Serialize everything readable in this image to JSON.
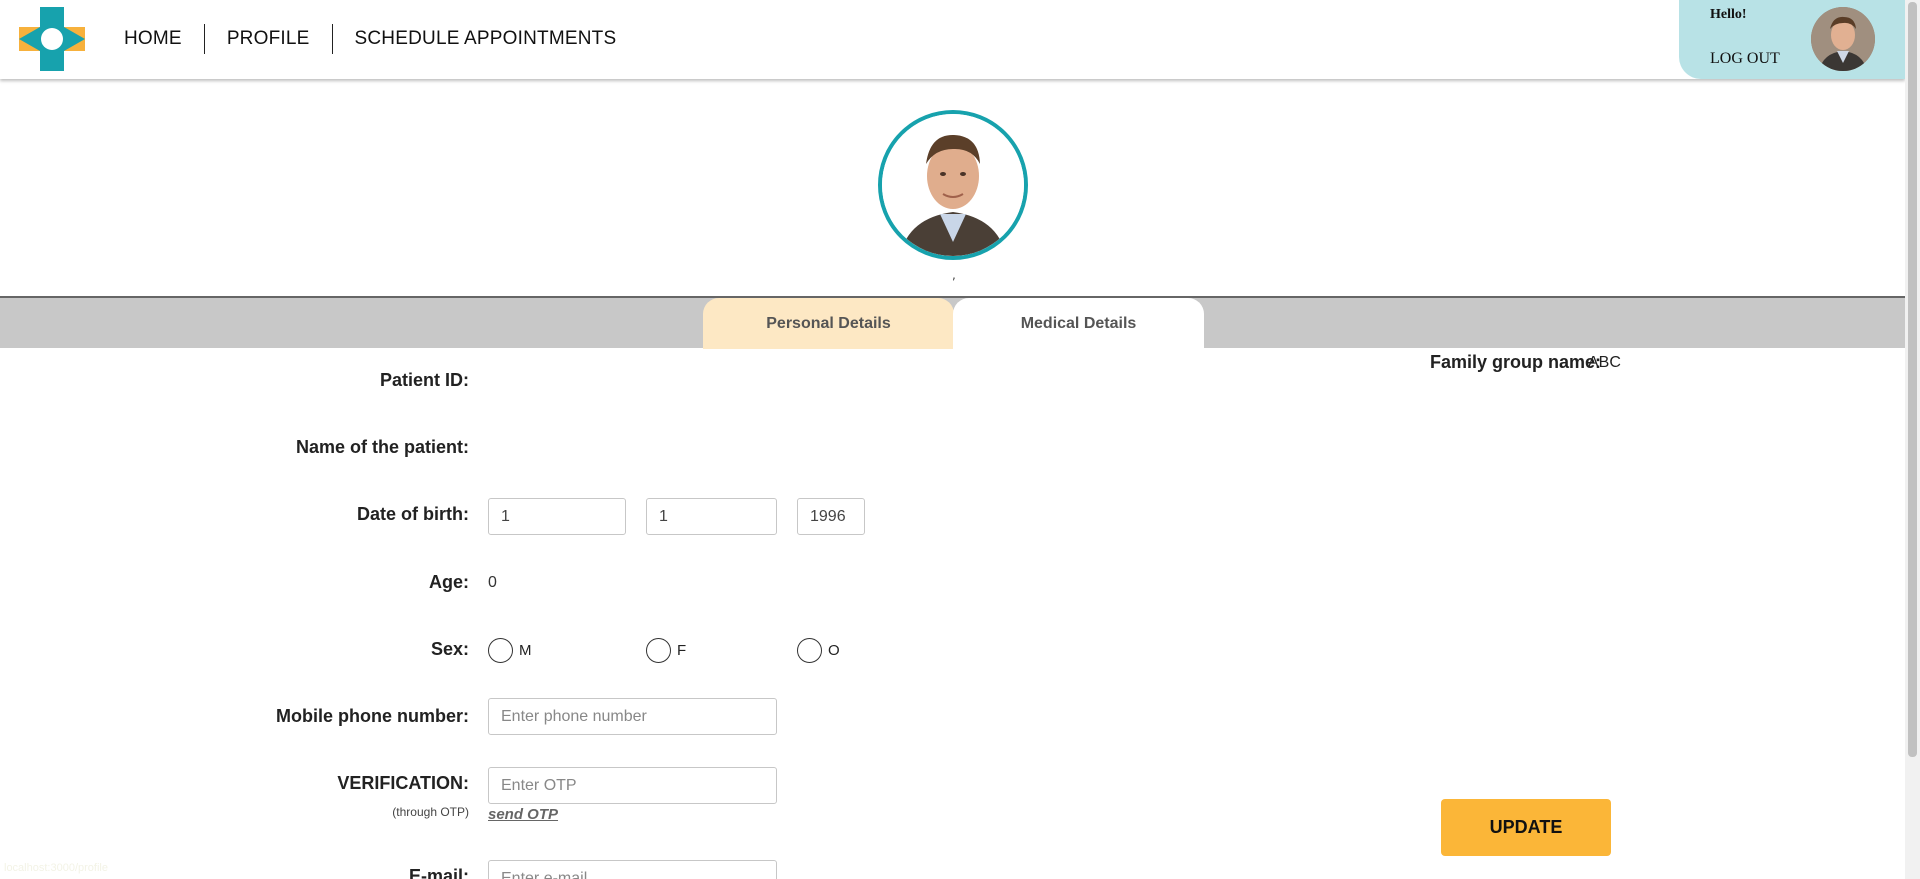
{
  "nav": {
    "home": "HOME",
    "profile": "PROFILE",
    "schedule": "SCHEDULE APPOINTMENTS"
  },
  "user": {
    "greeting": "Hello!",
    "logout": "LOG OUT"
  },
  "profile": {
    "caption": ","
  },
  "tabs": {
    "personal": "Personal Details",
    "medical": "Medical Details"
  },
  "form": {
    "patient_id_label": "Patient ID:",
    "patient_id_value": "",
    "name_label": "Name of the patient:",
    "name_value": "",
    "dob_label": "Date of birth:",
    "dob_day": "1",
    "dob_month": "1",
    "dob_year": "1996",
    "age_label": "Age:",
    "age_value": "0",
    "sex_label": "Sex:",
    "sex_options": [
      "M",
      "F",
      "O"
    ],
    "phone_label": "Mobile phone number:",
    "phone_placeholder": "Enter phone number",
    "verification_label": "VERIFICATION:",
    "verification_sub": "(through OTP)",
    "otp_placeholder": "Enter OTP",
    "send_otp": "send OTP",
    "email_label": "E-mail:",
    "email_placeholder": "Enter e-mail"
  },
  "family": {
    "label": "Family group name:",
    "value": "ABC"
  },
  "update_button": "UPDATE",
  "status_url": "localhost:3000/profile",
  "colors": {
    "accent_teal": "#17a2ad",
    "user_panel": "#b8e2e6",
    "tab_active": "#fde8c4",
    "update_button": "#fbb638",
    "logo_orange": "#f7b13c"
  }
}
